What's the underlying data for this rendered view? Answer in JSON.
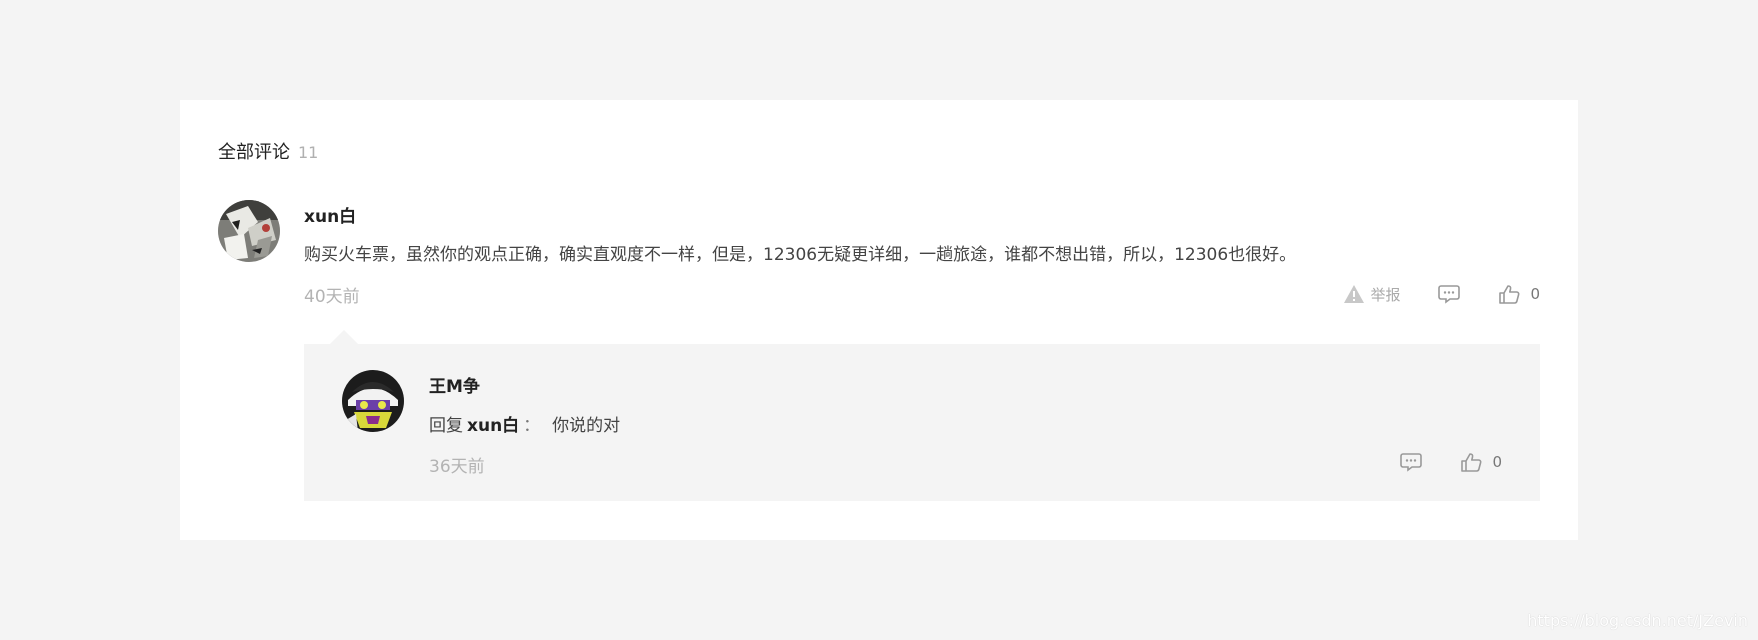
{
  "comments_section": {
    "heading": "全部评论",
    "count": "11"
  },
  "comment": {
    "author": "xun白",
    "text": "购买火车票，虽然你的观点正确，确实直观度不一样，但是，12306无疑更详细，一趟旅途，谁都不想出错，所以，12306也很好。",
    "time": "40天前",
    "avatar_icon": "avatar-photo",
    "actions": {
      "report_label": "举报",
      "report_icon": "warning-icon",
      "reply_icon": "comment-icon",
      "like_icon": "thumbs-up-icon",
      "like_count": "0"
    }
  },
  "reply": {
    "author": "王M争",
    "prefix": "回复",
    "reply_to": "xun白",
    "colon": "：",
    "text": "你说的对",
    "time": "36天前",
    "avatar_icon": "avatar-cartoon",
    "actions": {
      "reply_icon": "comment-icon",
      "like_icon": "thumbs-up-icon",
      "like_count": "0"
    }
  },
  "watermark": "https://blog.csdn.net/JZevin",
  "colors": {
    "page_bg": "#f4f4f4",
    "panel_bg": "#ffffff",
    "muted_text": "#b3b3b3",
    "reply_bg": "#f4f4f4"
  }
}
